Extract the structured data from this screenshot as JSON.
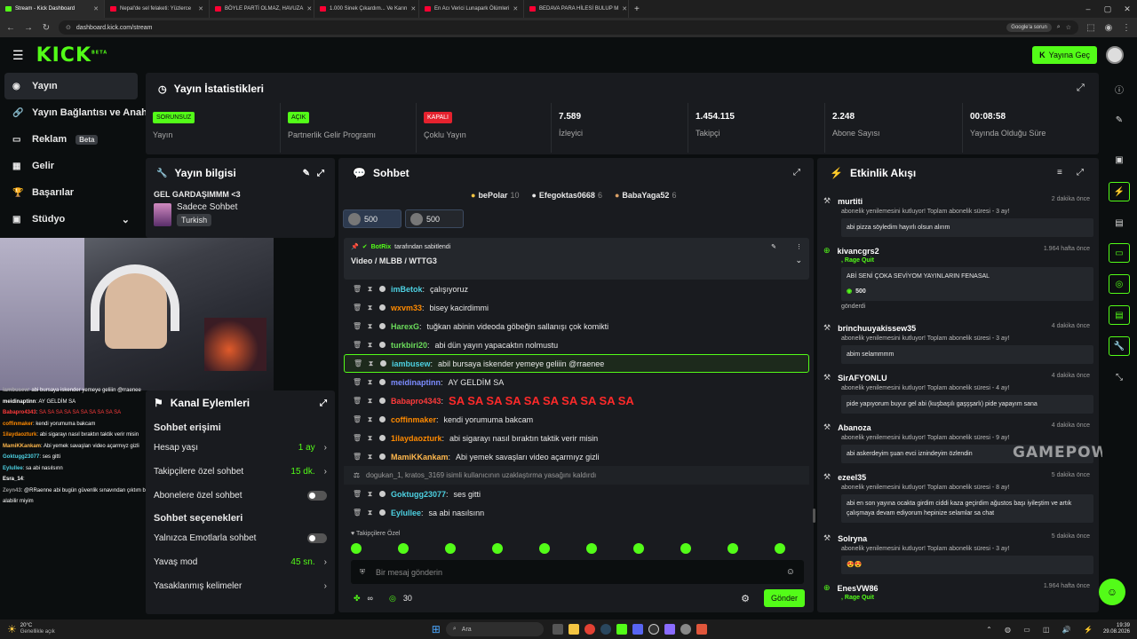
{
  "browser": {
    "tabs": [
      {
        "label": "Stream - Kick Dashboard",
        "color": "#53fc18",
        "active": true
      },
      {
        "label": "Nepal'de sel felaketi: Yüzlerce",
        "color": "#ff0033"
      },
      {
        "label": "BÖYLE PARTİ OLMAZ, HAVUZA",
        "color": "#ff0033"
      },
      {
        "label": "1.000 Sinek Çıkardım... Ve Karın",
        "color": "#ff0033"
      },
      {
        "label": "En Acı Verici Lunapark Ölümleri",
        "color": "#ff0033"
      },
      {
        "label": "BEDAVA PARA HİLESİ BULUP M",
        "color": "#ff0033"
      }
    ],
    "url": "dashboard.kick.com/stream",
    "google_label": "Google'a sorun"
  },
  "header": {
    "logo": "KICK",
    "logo_sup": "BETA",
    "go_live": "Yayına Geç"
  },
  "sidebar": {
    "items": [
      {
        "label": "Yayın",
        "icon": "broadcast-icon",
        "active": true
      },
      {
        "label": "Yayın Bağlantısı ve Anahtarı",
        "icon": "link-icon"
      },
      {
        "label": "Reklam",
        "icon": "ad-icon",
        "badge": "Beta"
      },
      {
        "label": "Gelir",
        "icon": "money-icon"
      },
      {
        "label": "Başarılar",
        "icon": "trophy-icon"
      },
      {
        "label": "Stüdyo",
        "icon": "studio-icon",
        "caret": "⌄"
      }
    ]
  },
  "stats": {
    "title": "Yayın İstatistikleri",
    "cards": [
      {
        "tag": "SORUNSUZ",
        "tag_bg": "#53fc18",
        "tag_color": "#0b0e0f",
        "label": "Yayın"
      },
      {
        "tag": "AÇIK",
        "tag_bg": "#53fc18",
        "tag_color": "#0b0e0f",
        "label": "Partnerlik Gelir Programı"
      },
      {
        "tag": "KAPALI",
        "tag_bg": "#e5222e",
        "tag_color": "#ffffff",
        "label": "Çoklu Yayın"
      },
      {
        "value": "7.589",
        "label": "İzleyici"
      },
      {
        "value": "1.454.115",
        "label": "Takipçi"
      },
      {
        "value": "2.248",
        "label": "Abone Sayısı"
      },
      {
        "value": "00:08:58",
        "label": "Yayında Olduğu Süre"
      }
    ]
  },
  "info": {
    "title": "Yayın bilgisi",
    "stream_title": "GEL GARDAŞIMMM <3",
    "category": "Sadece Sohbet",
    "language": "Turkish"
  },
  "chat": {
    "title": "Sohbet",
    "top_gifters": [
      {
        "name": "bePolar",
        "count": "10"
      },
      {
        "name": "Efegoktas0668",
        "count": "6"
      },
      {
        "name": "BabaYaga52",
        "count": "6"
      }
    ],
    "sub_gifts": [
      "500",
      "500"
    ],
    "pinned": {
      "by": "BotRix",
      "by_suffix": "tarafından sabitlendi",
      "text": "Video / MLBB / WTTG3"
    },
    "messages": [
      {
        "user": "imBetok",
        "color": "#4dd0e1",
        "text": "çalışıyoruz"
      },
      {
        "user": "wxvm33",
        "color": "#ff8a00",
        "text": "bisey kacirdimmi"
      },
      {
        "user": "HarexG",
        "color": "#6bdb5b",
        "text": "tuğkan abinin videoda göbeğin sallanışı çok komikti"
      },
      {
        "user": "turkbiri20",
        "color": "#6bdb5b",
        "text": "abi dün yayın yapacaktın nolmustu"
      },
      {
        "user": "iambusew",
        "color": "#4dd0e1",
        "text": "abil bursaya iskender yemeye geliiin @rraenee",
        "highlight": true
      },
      {
        "user": "meidinaptinn",
        "color": "#7c8cff",
        "text": "AY GELDİM SA"
      },
      {
        "user": "Babapro4343",
        "color": "#ff3b3b",
        "text": "SA SA SA SA SA SA SA SA SA SA",
        "big": true
      },
      {
        "user": "coffinmaker",
        "color": "#ff8a00",
        "text": "kendi yorumuma bakcam"
      },
      {
        "user": "1ilaydaozturk",
        "color": "#ff8a00",
        "text": "abi sigarayı nasıl bıraktın taktik verir misin"
      },
      {
        "user": "MamiKKankam",
        "color": "#ffb84d",
        "text": "Abi yemek savaşları video açarmıyz gizli"
      },
      {
        "system": true,
        "text": "dogukan_1, kratos_3169 isimli kullanıcının uzaklaştırma yasağını kaldırdı"
      },
      {
        "user": "Goktugg23077",
        "color": "#4dd0e1",
        "text": "ses gitti"
      },
      {
        "user": "Eylullee",
        "color": "#4dd0e1",
        "text": "sa abi nasılsınn"
      }
    ],
    "followers_label": "Takipçilere Özel",
    "input_placeholder": "Bir mesaj gönderin",
    "points": "30",
    "send": "Gönder"
  },
  "events": {
    "title": "Etkinlik Akışı",
    "items": [
      {
        "name": "murtiti",
        "time": "2 dakika önce",
        "desc": "abonelik yenilemesini kutluyor! Toplam abonelik süresi - 3 ay!",
        "box": "abi pizza söyledim hayırlı olsun alırım"
      },
      {
        "name": "kivancgrs2",
        "time": "1.964 hafta önce",
        "sub": ", Rage Quit",
        "box": "ABİ SENİ ÇOKA SEVİYOM YAYINLARIN FENASAL",
        "amount": "500",
        "after": "gönderdi"
      },
      {
        "name": "brinchuuyakissew35",
        "time": "4 dakika önce",
        "desc": "abonelik yenilemesini kutluyor! Toplam abonelik süresi - 3 ay!",
        "box": "abim selammmm"
      },
      {
        "name": "SirAFYONLU",
        "time": "4 dakika önce",
        "desc": "abonelik yenilemesini kutluyor! Toplam abonelik süresi - 4 ay!",
        "box": "pide yapıyorum buyur gel abi (kuşbaşılı gaşşşarlı) pide yapayım sana"
      },
      {
        "name": "Abanoza",
        "time": "4 dakika önce",
        "desc": "abonelik yenilemesini kutluyor! Toplam abonelik süresi - 9 ay!",
        "box": "abi askerdeyim şuan evci iznindeyim özlendin"
      },
      {
        "name": "ezeel35",
        "time": "5 dakika önce",
        "desc": "abonelik yenilemesini kutluyor! Toplam abonelik süresi - 8 ay!",
        "box": "abi en son yayına ocakta girdim ciddi kaza geçirdim ağustos başı iyileştim ve artık çalışmaya devam ediyorum hepinize selamlar sa chat"
      },
      {
        "name": "Solryna",
        "time": "5 dakika önce",
        "desc": "abonelik yenilemesini kutluyor! Toplam abonelik süresi - 3 ay!",
        "box": "😍😍"
      },
      {
        "name": "EnesVW86",
        "time": "1.964 hafta önce",
        "sub": ", Rage Quit"
      }
    ]
  },
  "watermark": "GAMEPOWER",
  "actions": {
    "title": "Kanal Eylemleri",
    "section1": "Sohbet erişimi",
    "rows1": [
      {
        "label": "Hesap yaşı",
        "value": "1 ay"
      },
      {
        "label": "Takipçilere özel sohbet",
        "value": "15 dk."
      },
      {
        "label": "Abonelere özel sohbet",
        "toggle": true
      }
    ],
    "section2": "Sohbet seçenekleri",
    "rows2": [
      {
        "label": "Yalnızca Emotlarla sohbet",
        "toggle": true
      },
      {
        "label": "Yavaş mod",
        "value": "45 sn."
      },
      {
        "label": "Yasaklanmış kelimeler",
        "value": ""
      }
    ]
  },
  "overlay_chat": [
    {
      "user": "iambusew",
      "text": "abi bursaya iskender yemeye geliiin @rraenee",
      "color": "#aaa"
    },
    {
      "user": "meidinaptinn",
      "text": "AY GELDİM SA",
      "color": "#fff"
    },
    {
      "user": "Babapro4343",
      "text": "SA SA SA SA SA SA SA SA SA SA",
      "color": "#ff3b3b"
    },
    {
      "user": "coffinmaker",
      "text": "kendi yorumuma bakcam",
      "color": "#ff8a00"
    },
    {
      "user": "1ilaydaozturk",
      "text": "abi sigarayı nasıl bıraktın taktik verir misin",
      "color": "#ff8a00"
    },
    {
      "user": "MamiKKankam",
      "text": "Abi yemek savaşları video açarmıyz gizli",
      "color": "#ffb84d"
    },
    {
      "user": "Goktugg23077",
      "text": "ses gitti",
      "color": "#4dd0e1"
    },
    {
      "user": "Eylullee",
      "text": "sa abi nasılsınn",
      "color": "#4dd0e1"
    },
    {
      "user": "Esra_14",
      "text": "",
      "color": "#fff"
    },
    {
      "user": "Zeyn43",
      "text": "@RRaenne abi bugün güvenlik sınavından çıktım bi geçmiş olsun",
      "color": "#999"
    },
    {
      "user": "",
      "text": "alabilir miyim",
      "color": "#999"
    }
  ],
  "taskbar": {
    "weather_temp": "20°C",
    "weather_desc": "Genellikle açık",
    "search": "Ara",
    "time": "19:39",
    "date": "29.08.2026"
  }
}
